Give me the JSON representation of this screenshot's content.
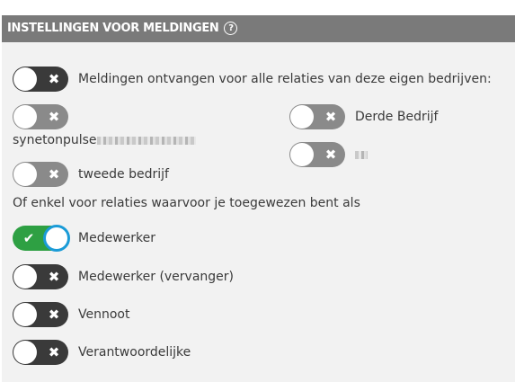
{
  "header": {
    "title": "INSTELLINGEN VOOR MELDINGEN",
    "help_glyph": "?"
  },
  "company_section": {
    "all_relations_label": "Meldingen ontvangen voor alle relaties van deze eigen bedrijven:",
    "all_relations_enabled": false,
    "companies": [
      {
        "label": "synetonpulse",
        "enabled": false,
        "redacted": true
      },
      {
        "label": "Derde Bedrijf",
        "enabled": false,
        "redacted": false
      },
      {
        "label": "",
        "enabled": false,
        "redacted": true
      },
      {
        "label": "tweede bedrijf",
        "enabled": false,
        "redacted": false
      }
    ]
  },
  "role_section": {
    "heading": "Of enkel voor relaties waarvoor je toegewezen bent als",
    "roles": [
      {
        "label": "Medewerker",
        "enabled": true
      },
      {
        "label": "Medewerker (vervanger)",
        "enabled": false
      },
      {
        "label": "Vennoot",
        "enabled": false
      },
      {
        "label": "Verantwoordelijke",
        "enabled": false
      }
    ]
  },
  "icons": {
    "off_mark": "✖",
    "on_mark": "✔"
  },
  "colors": {
    "header_bg": "#7a7a7a",
    "panel_bg": "#f2f2f2",
    "toggle_off": "#3a3a3a",
    "toggle_off_light": "#8a8a8a",
    "toggle_on": "#2ea043",
    "focus_ring": "#1a9bd7"
  }
}
